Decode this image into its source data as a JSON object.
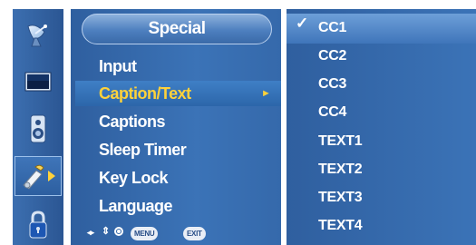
{
  "menu": {
    "title": "Special",
    "items": [
      {
        "label": "Input"
      },
      {
        "label": "Caption/Text",
        "active": true
      },
      {
        "label": "Captions"
      },
      {
        "label": "Sleep Timer"
      },
      {
        "label": "Key Lock"
      },
      {
        "label": "Language"
      }
    ],
    "submenu_indicator": "►"
  },
  "sidebar": {
    "icons": [
      "satellite-dish-icon",
      "screen-icon",
      "speaker-icon",
      "tools-icon",
      "lock-icon"
    ],
    "selected": "tools-icon"
  },
  "submenu": {
    "options": [
      {
        "label": "CC1",
        "checked": true
      },
      {
        "label": "CC2"
      },
      {
        "label": "CC3"
      },
      {
        "label": "CC4"
      },
      {
        "label": "TEXT1"
      },
      {
        "label": "TEXT2"
      },
      {
        "label": "TEXT3"
      },
      {
        "label": "TEXT4"
      }
    ],
    "check_mark": "✓"
  },
  "hints": {
    "lr_arrows": "◂▸",
    "ud_arrows": "⇕",
    "menu_label": "MENU",
    "exit_label": "EXIT"
  },
  "colors": {
    "panel": "#3569ab",
    "active_text": "#ffd23a",
    "text": "#ffffff"
  }
}
